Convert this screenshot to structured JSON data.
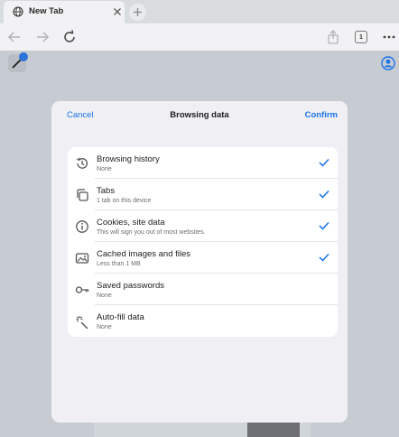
{
  "browser": {
    "tab_title": "New Tab",
    "tab_count": "1"
  },
  "dialog": {
    "cancel_label": "Cancel",
    "title": "Browsing data",
    "confirm_label": "Confirm",
    "items": [
      {
        "title": "Browsing history",
        "subtitle": "None",
        "checked": true,
        "icon": "history-icon"
      },
      {
        "title": "Tabs",
        "subtitle": "1 tab on this device",
        "checked": true,
        "icon": "tabs-icon"
      },
      {
        "title": "Cookies, site data",
        "subtitle": "This will sign you out of most websites.",
        "checked": true,
        "icon": "info-icon"
      },
      {
        "title": "Cached images and files",
        "subtitle": "Less than 1 MB",
        "checked": true,
        "icon": "image-icon"
      },
      {
        "title": "Saved passwords",
        "subtitle": "None",
        "checked": false,
        "icon": "key-icon"
      },
      {
        "title": "Auto-fill data",
        "subtitle": "None",
        "checked": false,
        "icon": "autofill-icon"
      }
    ]
  },
  "colors": {
    "accent": "#1a73e8",
    "sheet_bg": "#f0f0f4",
    "page_bg": "#c6ccd2"
  }
}
